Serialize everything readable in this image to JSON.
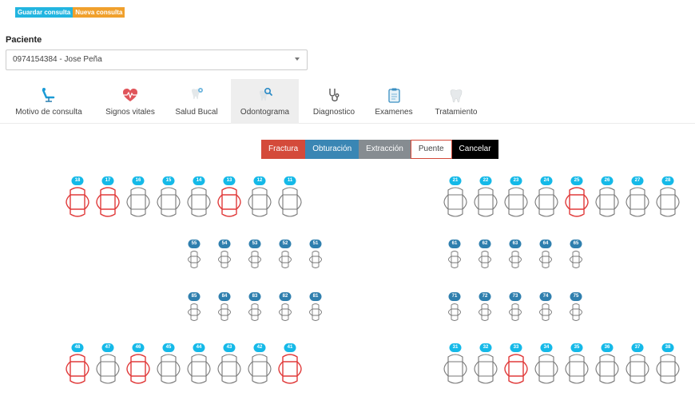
{
  "toolbar": {
    "save_label": "Guardar consulta",
    "new_label": "Nueva consulta"
  },
  "patient": {
    "label": "Paciente",
    "selected": "0974154384 - Jose Peña"
  },
  "tabs": [
    {
      "label": "Motivo de consulta",
      "icon": "dental-chair-icon"
    },
    {
      "label": "Signos vitales",
      "icon": "heartbeat-icon"
    },
    {
      "label": "Salud Bucal",
      "icon": "tooth-sparkle-icon"
    },
    {
      "label": "Odontograma",
      "icon": "tooth-search-icon",
      "active": true
    },
    {
      "label": "Diagnostico",
      "icon": "stethoscope-icon"
    },
    {
      "label": "Examenes",
      "icon": "clipboard-icon"
    },
    {
      "label": "Tratamiento",
      "icon": "tooth-icon"
    }
  ],
  "actions": {
    "fracture": "Fractura",
    "filling": "Obturación",
    "extraction": "Extracción",
    "bridge": "Puente",
    "cancel": "Cancelar"
  },
  "colors": {
    "cyan_badge": "#14b9e8",
    "steel_badge": "#2f7fae",
    "marked": "#e03a3a",
    "normal": "#777777"
  },
  "odontogram": {
    "upper_right_adult": [
      {
        "n": "18",
        "marked": true
      },
      {
        "n": "17",
        "marked": true
      },
      {
        "n": "16"
      },
      {
        "n": "15"
      },
      {
        "n": "14"
      },
      {
        "n": "13",
        "marked": true
      },
      {
        "n": "12"
      },
      {
        "n": "11"
      }
    ],
    "upper_left_adult": [
      {
        "n": "21"
      },
      {
        "n": "22"
      },
      {
        "n": "23"
      },
      {
        "n": "24"
      },
      {
        "n": "25",
        "marked": true
      },
      {
        "n": "26"
      },
      {
        "n": "27"
      },
      {
        "n": "28"
      }
    ],
    "upper_right_child": [
      {
        "n": "55"
      },
      {
        "n": "54"
      },
      {
        "n": "53"
      },
      {
        "n": "52"
      },
      {
        "n": "51"
      }
    ],
    "upper_left_child": [
      {
        "n": "61"
      },
      {
        "n": "62"
      },
      {
        "n": "63"
      },
      {
        "n": "64"
      },
      {
        "n": "65"
      }
    ],
    "lower_right_child": [
      {
        "n": "85"
      },
      {
        "n": "84"
      },
      {
        "n": "83"
      },
      {
        "n": "82"
      },
      {
        "n": "81"
      }
    ],
    "lower_left_child": [
      {
        "n": "71"
      },
      {
        "n": "72"
      },
      {
        "n": "73"
      },
      {
        "n": "74"
      },
      {
        "n": "75"
      }
    ],
    "lower_right_adult": [
      {
        "n": "48",
        "marked": true
      },
      {
        "n": "47"
      },
      {
        "n": "46",
        "marked": true
      },
      {
        "n": "45"
      },
      {
        "n": "44"
      },
      {
        "n": "43"
      },
      {
        "n": "42"
      },
      {
        "n": "41",
        "marked": true
      }
    ],
    "lower_left_adult": [
      {
        "n": "31"
      },
      {
        "n": "32"
      },
      {
        "n": "33",
        "marked": true
      },
      {
        "n": "34"
      },
      {
        "n": "35"
      },
      {
        "n": "36"
      },
      {
        "n": "37"
      },
      {
        "n": "38"
      }
    ]
  }
}
